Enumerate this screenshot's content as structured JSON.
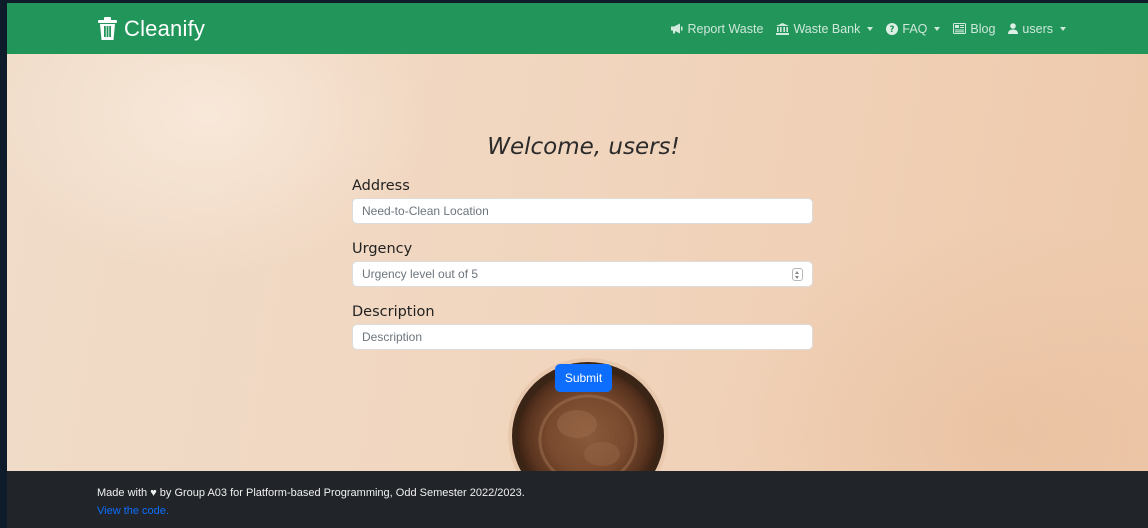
{
  "navbar": {
    "brand": "Cleanify",
    "links": [
      {
        "label": "Report Waste",
        "icon": "megaphone-icon"
      },
      {
        "label": "Waste Bank",
        "icon": "bank-icon",
        "dropdown": true
      },
      {
        "label": "FAQ",
        "icon": "question-circle-icon",
        "dropdown": true
      },
      {
        "label": "Blog",
        "icon": "newspaper-icon"
      },
      {
        "label": "users",
        "icon": "person-icon",
        "dropdown": true
      }
    ],
    "color": "#22965a"
  },
  "form": {
    "title": "Welcome, users!",
    "address": {
      "label": "Address",
      "placeholder": "Need-to-Clean Location"
    },
    "urgency": {
      "label": "Urgency",
      "placeholder": "Urgency level out of 5"
    },
    "description": {
      "label": "Description",
      "placeholder": "Description"
    },
    "submit_label": "Submit"
  },
  "footer": {
    "text": "Made with ♥ by Group A03 for Platform-based Programming, Odd Semester 2022/2023.",
    "link": "View the code."
  },
  "colors": {
    "primary": "#0d6efd",
    "footer_bg": "#212529"
  }
}
